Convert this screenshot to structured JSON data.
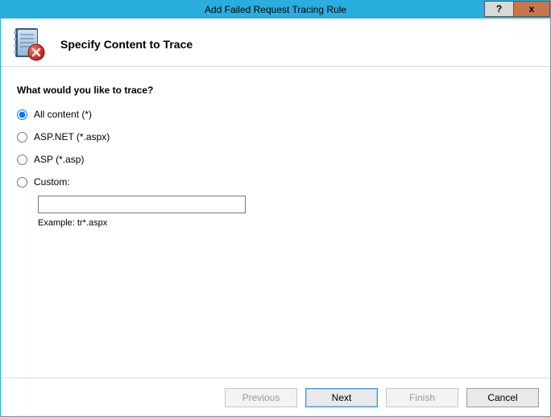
{
  "window": {
    "title": "Add Failed Request Tracing Rule"
  },
  "header": {
    "title": "Specify Content to Trace"
  },
  "content": {
    "question": "What would you like to trace?",
    "options": {
      "all": "All content (*)",
      "aspnet": "ASP.NET (*.aspx)",
      "asp": "ASP (*.asp)",
      "custom": "Custom:"
    },
    "custom_value": "",
    "example": "Example: tr*.aspx",
    "selected": "all"
  },
  "footer": {
    "previous": "Previous",
    "next": "Next",
    "finish": "Finish",
    "cancel": "Cancel"
  }
}
